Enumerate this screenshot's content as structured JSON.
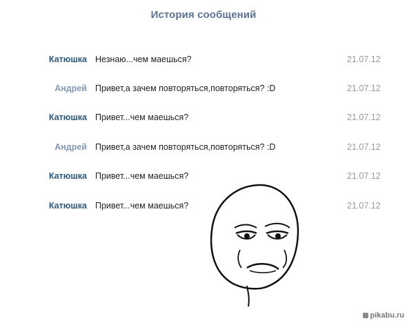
{
  "header": {
    "title": "История сообщений"
  },
  "colors": {
    "sender_self": "#2b587a",
    "sender_other": "#8499b2",
    "date": "#999999",
    "title": "#5b7290"
  },
  "messages": [
    {
      "sender": "Катюшка",
      "text": "Незнаю...чем маешься?",
      "date": "21.07.12",
      "side": "self"
    },
    {
      "sender": "Андрей",
      "text": "Привет,а зачем повторяться,повторяться? :D",
      "date": "21.07.12",
      "side": "other"
    },
    {
      "sender": "Катюшка",
      "text": "Привет...чем маешься?",
      "date": "21.07.12",
      "side": "self"
    },
    {
      "sender": "Андрей",
      "text": "Привет,а зачем повторяться,повторяться? :D",
      "date": "21.07.12",
      "side": "other"
    },
    {
      "sender": "Катюшка",
      "text": "Привет...чем маешься?",
      "date": "21.07.12",
      "side": "self"
    },
    {
      "sender": "Катюшка",
      "text": "Привет...чем маешься?",
      "date": "21.07.12",
      "side": "self"
    }
  ],
  "meme_face": {
    "icon": "are-you-serious-face-icon"
  },
  "watermark": {
    "text": "pikabu.ru"
  }
}
